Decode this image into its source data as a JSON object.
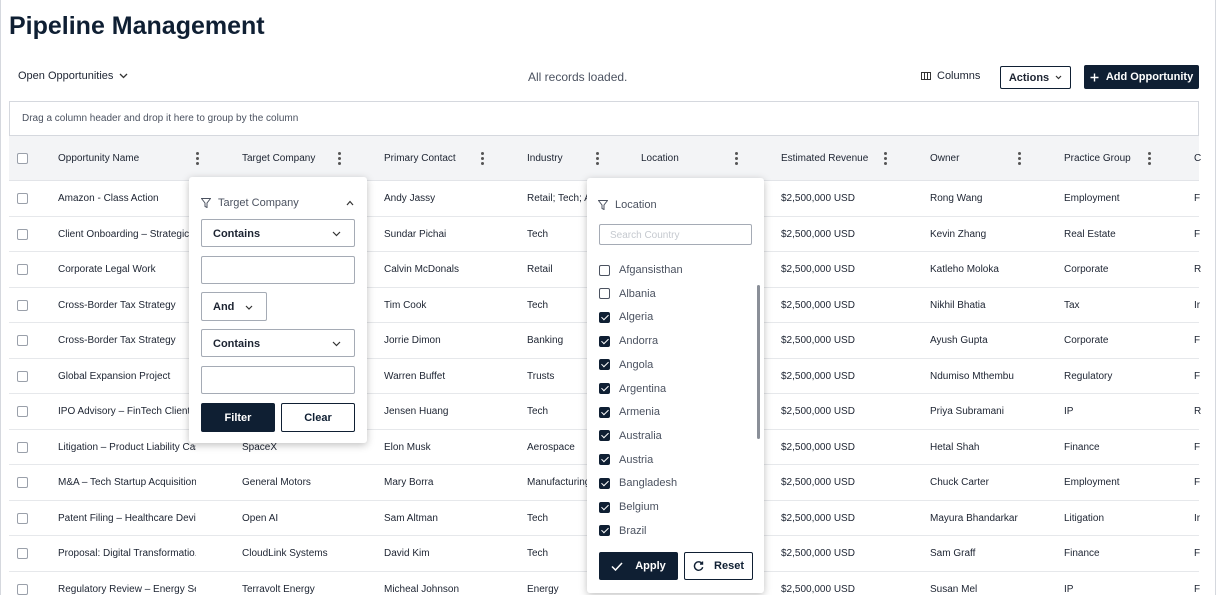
{
  "page": {
    "title": "Pipeline Management"
  },
  "toolbar": {
    "view_label": "Open Opportunities",
    "status_text": "All records loaded.",
    "columns_label": "Columns",
    "actions_label": "Actions",
    "add_label": "Add Opportunity"
  },
  "group_bar": {
    "text": "Drag a column header and drop it here to group by the column"
  },
  "columns": [
    "Opportunity Name",
    "Target Company",
    "Primary Contact",
    "Industry",
    "Location",
    "Estimated Revenue",
    "Owner",
    "Practice Group",
    "C"
  ],
  "rows": [
    {
      "name": "Amazon - Class Action",
      "company": "",
      "contact": "Andy Jassy",
      "industry": "Retail; Tech; A",
      "revenue": "$2,500,000 USD",
      "owner": "Rong Wang",
      "practice": "Employment",
      "extra": "F"
    },
    {
      "name": "Client Onboarding – Strategic",
      "company": "",
      "contact": "Sundar Pichai",
      "industry": "Tech",
      "revenue": "$2,500,000 USD",
      "owner": "Kevin Zhang",
      "practice": "Real Estate",
      "extra": "F"
    },
    {
      "name": "Corporate Legal Work",
      "company": "",
      "contact": "Calvin McDonals",
      "industry": "Retail",
      "revenue": "$2,500,000 USD",
      "owner": "Katleho Moloka",
      "practice": "Corporate",
      "extra": "R"
    },
    {
      "name": "Cross-Border Tax Strategy",
      "company": "",
      "contact": "Tim Cook",
      "industry": "Tech",
      "revenue": "$2,500,000 USD",
      "owner": "Nikhil Bhatia",
      "practice": "Tax",
      "extra": "Ir"
    },
    {
      "name": "Cross-Border Tax Strategy",
      "company": "",
      "contact": "Jorrie Dimon",
      "industry": "Banking",
      "revenue": "$2,500,000 USD",
      "owner": "Ayush Gupta",
      "practice": "Corporate",
      "extra": "F"
    },
    {
      "name": "Global Expansion Project",
      "company": "",
      "contact": "Warren Buffet",
      "industry": "Trusts",
      "revenue": "$2,500,000 USD",
      "owner": "Ndumiso Mthembu",
      "practice": "Regulatory",
      "extra": "F"
    },
    {
      "name": "IPO Advisory – FinTech Client",
      "company": "",
      "contact": "Jensen Huang",
      "industry": "Tech",
      "revenue": "$2,500,000 USD",
      "owner": "Priya Subramani",
      "practice": "IP",
      "extra": "R"
    },
    {
      "name": "Litigation – Product Liability Case",
      "company": "SpaceX",
      "contact": "Elon Musk",
      "industry": "Aerospace",
      "revenue": "$2,500,000 USD",
      "owner": "Hetal Shah",
      "practice": "Finance",
      "extra": "F"
    },
    {
      "name": "M&A – Tech Startup Acquisition",
      "company": "General Motors",
      "contact": "Mary Borra",
      "industry": "Manufacturing",
      "revenue": "$2,500,000 USD",
      "owner": "Chuck Carter",
      "practice": "Employment",
      "extra": "F"
    },
    {
      "name": "Patent Filing – Healthcare Devices",
      "company": "Open AI",
      "contact": "Sam Altman",
      "industry": "Tech",
      "revenue": "$2,500,000 USD",
      "owner": "Mayura Bhandarkar",
      "practice": "Litigation",
      "extra": "Ir"
    },
    {
      "name": "Proposal: Digital Transformatio...",
      "company": "CloudLink Systems",
      "contact": "David Kim",
      "industry": "Tech",
      "revenue": "$2,500,000 USD",
      "owner": "Sam Graff",
      "practice": "Finance",
      "extra": "F"
    },
    {
      "name": "Regulatory Review – Energy Sector",
      "company": "Terravolt Energy",
      "contact": "Micheal Johnson",
      "industry": "Energy",
      "revenue": "$2,500,000 USD",
      "owner": "Susan Mel",
      "practice": "IP",
      "extra": "F"
    }
  ],
  "company_filter": {
    "title": "Target Company",
    "condition1": "Contains",
    "value1": "",
    "join": "And",
    "condition2": "Contains",
    "value2": "",
    "filter_label": "Filter",
    "clear_label": "Clear"
  },
  "location_filter": {
    "title": "Location",
    "search_placeholder": "Search Country",
    "countries": [
      {
        "name": "Afgansisthan",
        "checked": false
      },
      {
        "name": "Albania",
        "checked": false
      },
      {
        "name": "Algeria",
        "checked": true
      },
      {
        "name": "Andorra",
        "checked": true
      },
      {
        "name": "Angola",
        "checked": true
      },
      {
        "name": "Argentina",
        "checked": true
      },
      {
        "name": "Armenia",
        "checked": true
      },
      {
        "name": "Australia",
        "checked": true
      },
      {
        "name": "Austria",
        "checked": true
      },
      {
        "name": "Bangladesh",
        "checked": true
      },
      {
        "name": "Belgium",
        "checked": true
      },
      {
        "name": "Brazil",
        "checked": true
      }
    ],
    "apply_label": "Apply",
    "reset_label": "Reset"
  },
  "colors": {
    "primary": "#0f1f33",
    "header_bg": "#f3f4f6"
  }
}
